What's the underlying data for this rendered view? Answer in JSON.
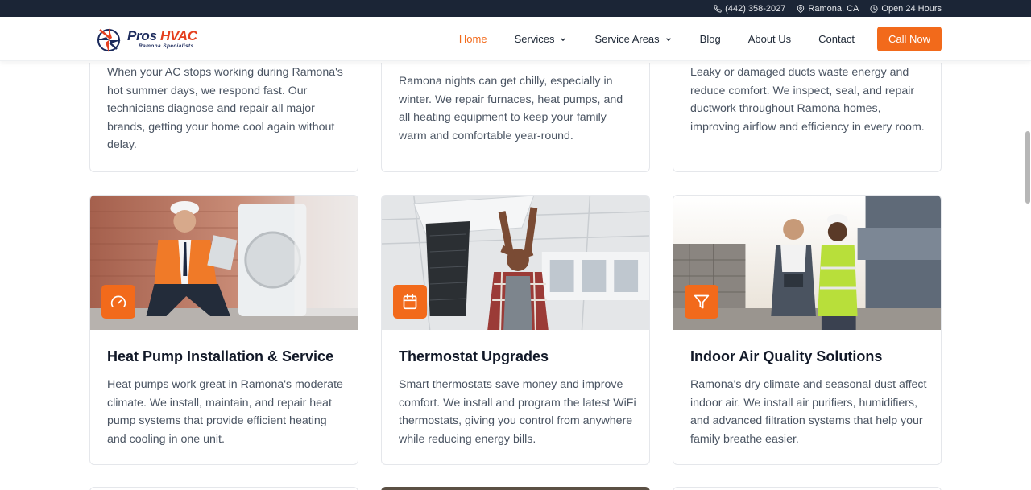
{
  "topbar": {
    "phone": "(442) 358-2027",
    "location": "Ramona, CA",
    "hours": "Open 24 Hours"
  },
  "brand": {
    "name_part1": "Pros",
    "name_part2": "HVAC",
    "tagline": "Ramona Specialists"
  },
  "nav": {
    "home": "Home",
    "services": "Services",
    "service_areas": "Service Areas",
    "blog": "Blog",
    "about": "About Us",
    "contact": "Contact",
    "call": "Call Now"
  },
  "top_cards": [
    {
      "text": "When your AC stops working during Ramona's hot summer days, we respond fast. Our technicians diagnose and repair all major brands, getting your home cool again without delay."
    },
    {
      "text": "Ramona nights can get chilly, especially in winter. We repair furnaces, heat pumps, and all heating equipment to keep your family warm and comfortable year-round."
    },
    {
      "text": "Leaky or damaged ducts waste energy and reduce comfort. We inspect, seal, and repair ductwork throughout Ramona homes, improving airflow and efficiency in every room."
    }
  ],
  "cards": [
    {
      "icon": "gauge-icon",
      "title": "Heat Pump Installation & Service",
      "text": "Heat pumps work great in Ramona's moderate climate. We install, maintain, and repair heat pump systems that provide efficient heating and cooling in one unit."
    },
    {
      "icon": "calendar-icon",
      "title": "Thermostat Upgrades",
      "text": "Smart thermostats save money and improve comfort. We install and program the latest WiFi thermostats, giving you control from anywhere while reducing energy bills."
    },
    {
      "icon": "filter-icon",
      "title": "Indoor Air Quality Solutions",
      "text": "Ramona's dry climate and seasonal dust affect indoor air. We install air purifiers, humidifiers, and advanced filtration systems that help your family breathe easier."
    }
  ],
  "colors": {
    "accent": "#f26a1b",
    "topbar": "#1b2536",
    "brand_navy": "#1b2a5c",
    "brand_red": "#e5401f"
  }
}
